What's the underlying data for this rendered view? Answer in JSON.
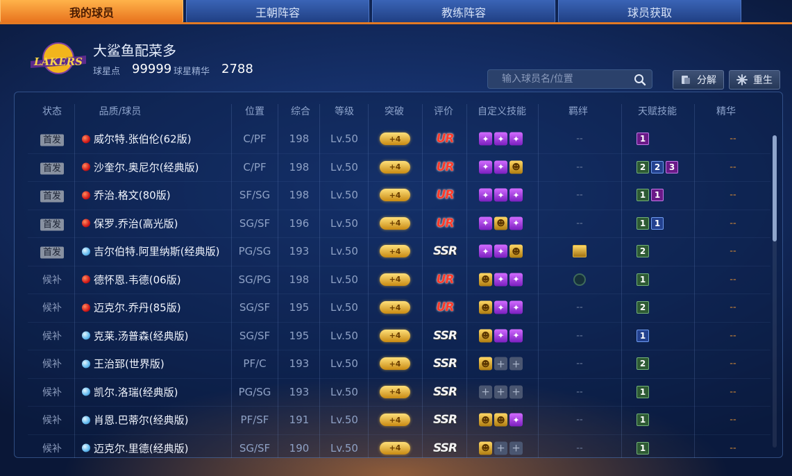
{
  "tabs": [
    {
      "label": "我的球员",
      "active": true
    },
    {
      "label": "王朝阵容",
      "active": false
    },
    {
      "label": "教练阵容",
      "active": false
    },
    {
      "label": "球员获取",
      "active": false
    }
  ],
  "team": {
    "logo_icon": "lakers-logo-icon",
    "name": "大鲨鱼配菜多",
    "star_points_label": "球星点",
    "star_points_value": "99999",
    "essence_label": "球星精华",
    "essence_value": "2788"
  },
  "search": {
    "placeholder": "输入球员名/位置"
  },
  "actions": {
    "decompose_label": "分解",
    "rebirth_label": "重生"
  },
  "columns": [
    "状态",
    "品质/球员",
    "位置",
    "综合",
    "等级",
    "突破",
    "评价",
    "自定义技能",
    "羁绊",
    "天赋技能",
    "精华"
  ],
  "players": [
    {
      "status": "首发",
      "starter": true,
      "rarity": "ur",
      "name": "威尔特.张伯伦(62版)",
      "pos": "C/PF",
      "overall": "198",
      "level": "Lv.50",
      "breakthrough": "+4",
      "grade": "UR",
      "skills": [
        "purple",
        "purple",
        "purple"
      ],
      "bond": "--",
      "talents": [
        {
          "v": "1",
          "c": "purple"
        }
      ],
      "essence": "--"
    },
    {
      "status": "首发",
      "starter": true,
      "rarity": "ur",
      "name": "沙奎尔.奥尼尔(经典版)",
      "pos": "C/PF",
      "overall": "198",
      "level": "Lv.50",
      "breakthrough": "+4",
      "grade": "UR",
      "skills": [
        "purple",
        "purple",
        "gold"
      ],
      "bond": "--",
      "talents": [
        {
          "v": "2",
          "c": "green"
        },
        {
          "v": "2",
          "c": "blue"
        },
        {
          "v": "3",
          "c": "purple"
        }
      ],
      "essence": "--"
    },
    {
      "status": "首发",
      "starter": true,
      "rarity": "ur",
      "name": "乔治.格文(80版)",
      "pos": "SF/SG",
      "overall": "198",
      "level": "Lv.50",
      "breakthrough": "+4",
      "grade": "UR",
      "skills": [
        "purple",
        "purple",
        "purple"
      ],
      "bond": "--",
      "talents": [
        {
          "v": "1",
          "c": "green"
        },
        {
          "v": "1",
          "c": "purple"
        }
      ],
      "essence": "--"
    },
    {
      "status": "首发",
      "starter": true,
      "rarity": "ur",
      "name": "保罗.乔治(高光版)",
      "pos": "SG/SF",
      "overall": "196",
      "level": "Lv.50",
      "breakthrough": "+4",
      "grade": "UR",
      "skills": [
        "purple",
        "gold",
        "purple"
      ],
      "bond": "--",
      "talents": [
        {
          "v": "1",
          "c": "green"
        },
        {
          "v": "1",
          "c": "blue"
        }
      ],
      "essence": "--"
    },
    {
      "status": "首发",
      "starter": true,
      "rarity": "ssr",
      "name": "吉尔伯特.阿里纳斯(经典版)",
      "pos": "PG/SG",
      "overall": "193",
      "level": "Lv.50",
      "breakthrough": "+4",
      "grade": "SSR",
      "skills": [
        "purple",
        "purple",
        "gold"
      ],
      "bond": "icon-gold",
      "talents": [
        {
          "v": "2",
          "c": "green"
        }
      ],
      "essence": "--"
    },
    {
      "status": "候补",
      "starter": false,
      "rarity": "ur",
      "name": "德怀恩.韦德(06版)",
      "pos": "SG/PG",
      "overall": "198",
      "level": "Lv.50",
      "breakthrough": "+4",
      "grade": "UR",
      "skills": [
        "gold",
        "purple",
        "purple"
      ],
      "bond": "icon-ring",
      "talents": [
        {
          "v": "1",
          "c": "green"
        }
      ],
      "essence": "--"
    },
    {
      "status": "候补",
      "starter": false,
      "rarity": "ur",
      "name": "迈克尔.乔丹(85版)",
      "pos": "SG/SF",
      "overall": "195",
      "level": "Lv.50",
      "breakthrough": "+4",
      "grade": "UR",
      "skills": [
        "gold",
        "purple",
        "purple"
      ],
      "bond": "--",
      "talents": [
        {
          "v": "2",
          "c": "green"
        }
      ],
      "essence": "--"
    },
    {
      "status": "候补",
      "starter": false,
      "rarity": "ssr",
      "name": "克莱.汤普森(经典版)",
      "pos": "SG/SF",
      "overall": "195",
      "level": "Lv.50",
      "breakthrough": "+4",
      "grade": "SSR",
      "skills": [
        "gold",
        "purple",
        "purple"
      ],
      "bond": "--",
      "talents": [
        {
          "v": "1",
          "c": "blue"
        }
      ],
      "essence": "--"
    },
    {
      "status": "候补",
      "starter": false,
      "rarity": "ssr",
      "name": "王治郅(世界版)",
      "pos": "PF/C",
      "overall": "193",
      "level": "Lv.50",
      "breakthrough": "+4",
      "grade": "SSR",
      "skills": [
        "gold",
        "empty",
        "empty"
      ],
      "bond": "--",
      "talents": [
        {
          "v": "2",
          "c": "green"
        }
      ],
      "essence": "--"
    },
    {
      "status": "候补",
      "starter": false,
      "rarity": "ssr",
      "name": "凯尔.洛瑞(经典版)",
      "pos": "PG/SG",
      "overall": "193",
      "level": "Lv.50",
      "breakthrough": "+4",
      "grade": "SSR",
      "skills": [
        "empty",
        "empty",
        "empty"
      ],
      "bond": "--",
      "talents": [
        {
          "v": "1",
          "c": "green"
        }
      ],
      "essence": "--"
    },
    {
      "status": "候补",
      "starter": false,
      "rarity": "ssr",
      "name": "肖恩.巴蒂尔(经典版)",
      "pos": "PF/SF",
      "overall": "191",
      "level": "Lv.50",
      "breakthrough": "+4",
      "grade": "SSR",
      "skills": [
        "gold",
        "gold",
        "purple"
      ],
      "bond": "--",
      "talents": [
        {
          "v": "1",
          "c": "green"
        }
      ],
      "essence": "--"
    },
    {
      "status": "候补",
      "starter": false,
      "rarity": "ssr",
      "name": "迈克尔.里德(经典版)",
      "pos": "SG/SF",
      "overall": "190",
      "level": "Lv.50",
      "breakthrough": "+4",
      "grade": "SSR",
      "skills": [
        "gold",
        "empty",
        "empty"
      ],
      "bond": "--",
      "talents": [
        {
          "v": "1",
          "c": "green"
        }
      ],
      "essence": "--"
    }
  ],
  "scrollbar": {
    "thumb_fraction": 0.34
  },
  "colors": {
    "accent": "#e7711d",
    "ur": "#ff3a2a",
    "talent_green": "#73b377",
    "talent_blue": "#6f9cf2",
    "talent_purple": "#c57ae8"
  }
}
